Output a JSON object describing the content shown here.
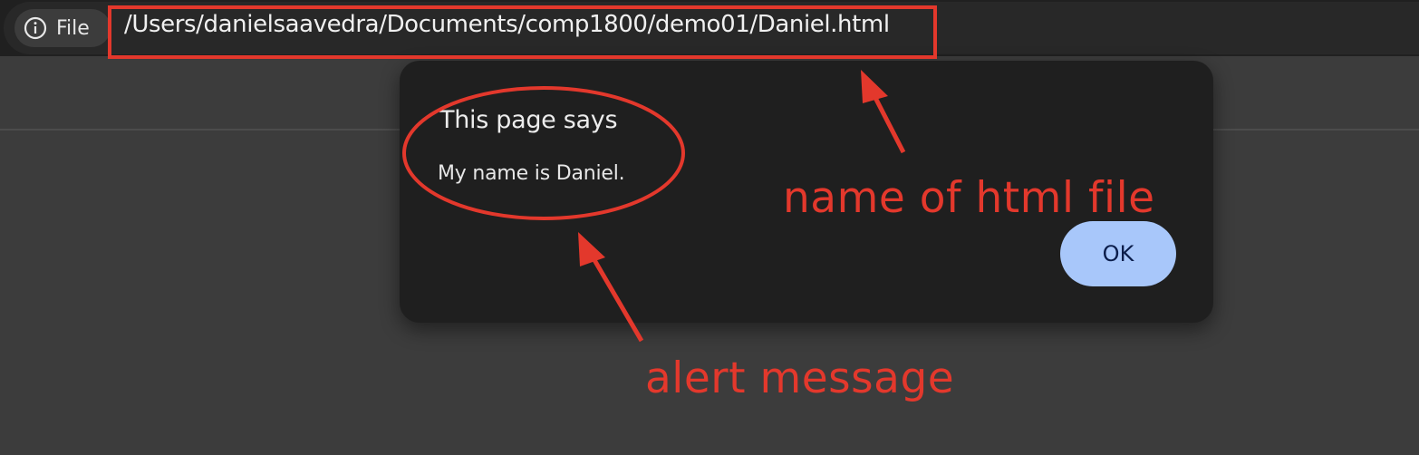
{
  "browser": {
    "chip_label": "File",
    "chip_icon": "info-icon",
    "url": "/Users/danielsaavedra/Documents/comp1800/demo01/Daniel.html"
  },
  "dialog": {
    "title": "This page says",
    "message": "My name is Daniel.",
    "ok_label": "OK"
  },
  "annotations": {
    "file_label": "name of html file",
    "alert_label": "alert message",
    "color": "#e3382c"
  },
  "colors": {
    "toolbar": "#202020",
    "page": "#3c3c3c",
    "dialog": "#1f1f1f",
    "ok_button": "#a8c7fa"
  }
}
